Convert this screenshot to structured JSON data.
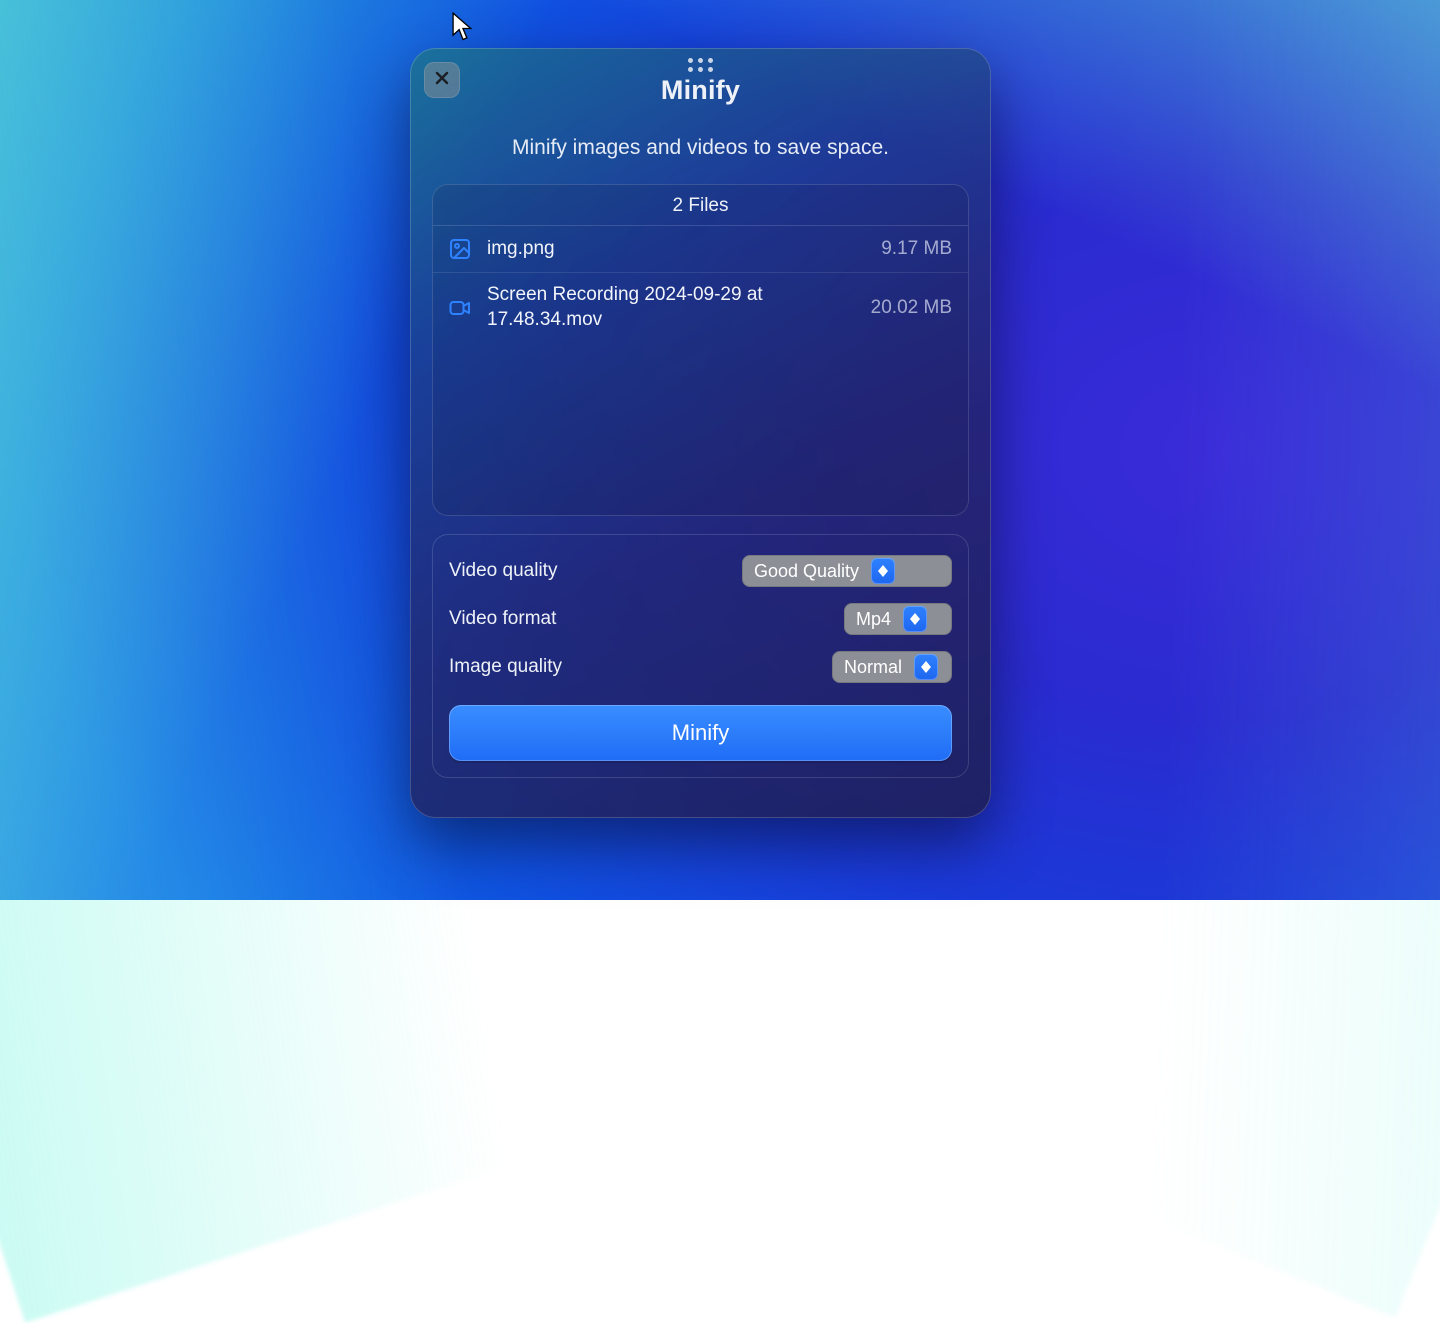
{
  "app": {
    "title": "Minify",
    "subtitle": "Minify images and videos to save space."
  },
  "files": {
    "header": "2 Files",
    "items": [
      {
        "icon": "image-icon",
        "name": "img.png",
        "size": "9.17 MB"
      },
      {
        "icon": "video-icon",
        "name": "Screen Recording 2024-09-29 at 17.48.34.mov",
        "size": "20.02 MB"
      }
    ]
  },
  "settings": {
    "video_quality": {
      "label": "Video quality",
      "value": "Good Quality"
    },
    "video_format": {
      "label": "Video format",
      "value": "Mp4"
    },
    "image_quality": {
      "label": "Image quality",
      "value": "Normal"
    },
    "action_label": "Minify"
  }
}
